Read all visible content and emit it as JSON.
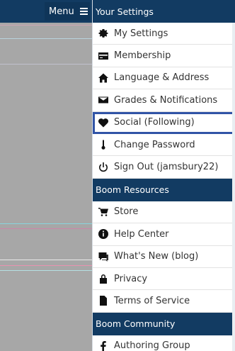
{
  "topbar": {
    "menu_label": "Menu"
  },
  "sections": [
    {
      "title": "Your Settings",
      "items": [
        {
          "label": "My Settings",
          "icon": "gear-icon"
        },
        {
          "label": "Membership",
          "icon": "card-icon"
        },
        {
          "label": "Language & Address",
          "icon": "home-icon"
        },
        {
          "label": "Grades & Notifications",
          "icon": "envelope-icon"
        },
        {
          "label": "Social (Following)",
          "icon": "heart-icon",
          "highlighted": true
        },
        {
          "label": "Change Password",
          "icon": "thermometer-icon"
        },
        {
          "label": "Sign Out (jamsbury22)",
          "icon": "power-icon"
        }
      ]
    },
    {
      "title": "Boom Resources",
      "items": [
        {
          "label": "Store",
          "icon": "cart-icon"
        },
        {
          "label": "Help Center",
          "icon": "info-icon"
        },
        {
          "label": "What's New (blog)",
          "icon": "chat-icon"
        },
        {
          "label": "Privacy",
          "icon": "lock-icon"
        },
        {
          "label": "Terms of Service",
          "icon": "document-icon"
        }
      ]
    },
    {
      "title": "Boom Community",
      "items": [
        {
          "label": "Authoring Group",
          "icon": "facebook-icon"
        }
      ]
    }
  ],
  "colors": {
    "header": "#123b62",
    "highlight": "#3154a6",
    "backdrop": "#a7a7a7"
  }
}
